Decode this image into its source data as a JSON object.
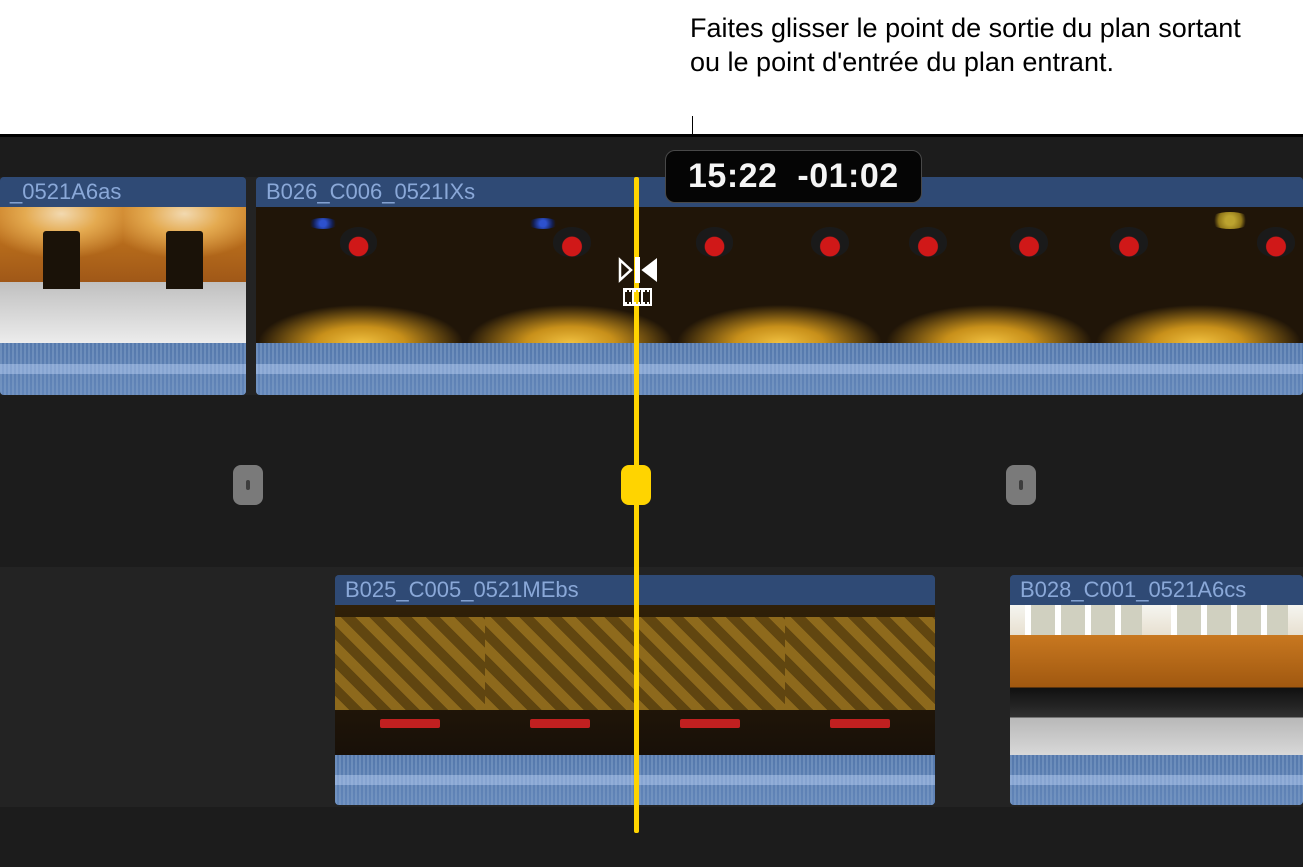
{
  "annotation": {
    "text": "Faites glisser le point de sortie du plan sortant ou le point d'entrée du plan entrant."
  },
  "timecode": {
    "duration": "15:22",
    "offset": "-01:02"
  },
  "clips": {
    "top_left": {
      "label": "_0521A6as"
    },
    "top_right": {
      "label": "B026_C006_0521IXs"
    },
    "bottom_left": {
      "label": "B025_C005_0521MEbs"
    },
    "bottom_right": {
      "label": "B028_C001_0521A6cs"
    }
  },
  "icons": {
    "trim_cursor": "trim-edge-cursor",
    "edit_marker": "edit-point-marker",
    "playhead": "playhead"
  }
}
